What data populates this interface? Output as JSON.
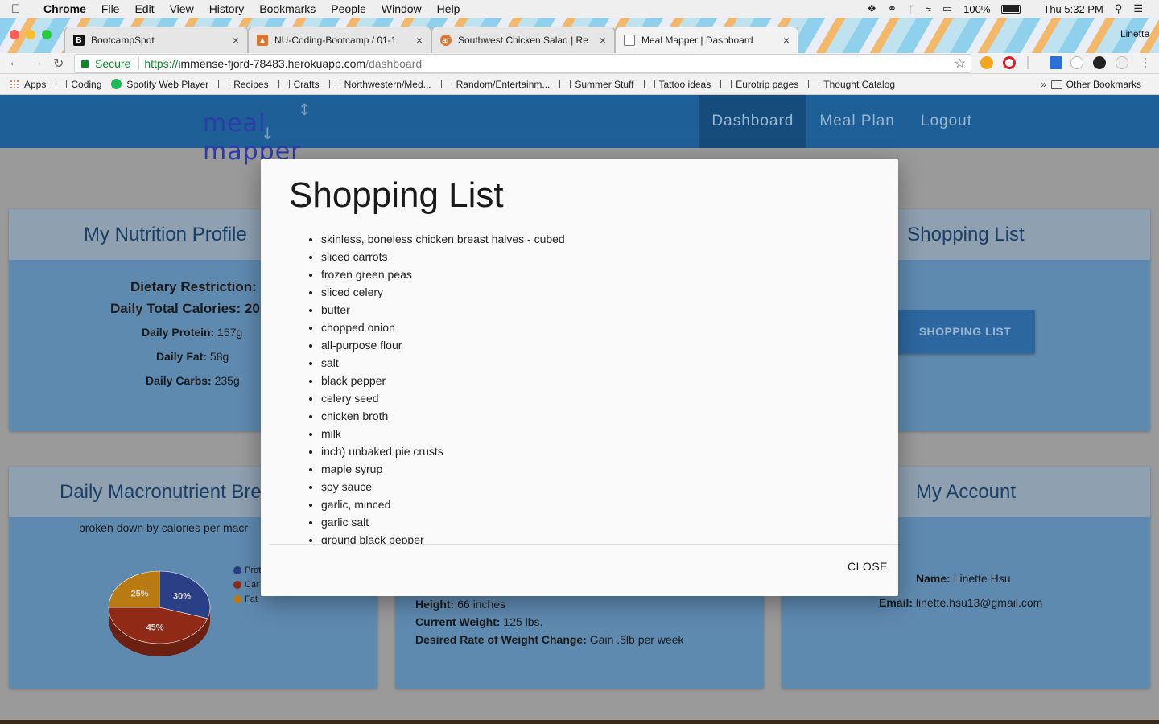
{
  "menubar": {
    "app": "Chrome",
    "items": [
      "File",
      "Edit",
      "View",
      "History",
      "Bookmarks",
      "People",
      "Window",
      "Help"
    ],
    "battery": "100%",
    "clock": "Thu 5:32 PM"
  },
  "tabs": [
    {
      "title": "BootcampSpot",
      "favicon": "B"
    },
    {
      "title": "NU-Coding-Bootcamp / 01-1",
      "favicon": "fox"
    },
    {
      "title": "Southwest Chicken Salad | Re",
      "favicon": "ar"
    },
    {
      "title": "Meal Mapper | Dashboard",
      "favicon": "doc"
    }
  ],
  "profile_name": "Linette",
  "omnibox": {
    "secure_label": "Secure",
    "url_scheme": "https://",
    "url_host": "immense-fjord-78483.herokuapp.com",
    "url_path": "/dashboard"
  },
  "bookmarks": [
    "Apps",
    "Coding",
    "Spotify Web Player",
    "Recipes",
    "Crafts",
    "Northwestern/Med...",
    "Random/Entertainm...",
    "Summer Stuff",
    "Tattoo ideas",
    "Eurotrip pages",
    "Thought Catalog"
  ],
  "other_bookmarks": "Other Bookmarks",
  "site": {
    "logo_text": "meal mapper",
    "nav": [
      "Dashboard",
      "Meal Plan",
      "Logout"
    ]
  },
  "nutrition_card": {
    "title": "My Nutrition Profile",
    "restriction_label": "Dietary Restriction:",
    "calories_label": "Daily Total Calories: 20",
    "protein_label": "Daily Protein:",
    "protein_value": " 157g",
    "fat_label": "Daily Fat:",
    "fat_value": " 58g",
    "carbs_label": "Daily Carbs:",
    "carbs_value": " 235g"
  },
  "shopping_card": {
    "title": "Shopping List",
    "button": "SHOPPING LIST"
  },
  "macro_card": {
    "title": "Daily Macronutrient Bre",
    "subtitle": "broken down by calories per macr",
    "legend": [
      "Prot",
      "Car",
      "Fat"
    ]
  },
  "chart_data": {
    "type": "pie",
    "categories": [
      "Protein",
      "Carbs",
      "Fat"
    ],
    "values": [
      30,
      45,
      25
    ],
    "labels": [
      "30%",
      "45%",
      "25%"
    ],
    "colors": [
      "#2a3f86",
      "#8e2a16",
      "#b97a12"
    ]
  },
  "body_card": {
    "height_label": "Height:",
    "height_value": " 66 inches",
    "weight_label": "Current Weight:",
    "weight_value": " 125 lbs.",
    "rate_label": "Desired Rate of Weight Change:",
    "rate_value": " Gain .5lb per week"
  },
  "account_card": {
    "title": "My Account",
    "name_label": "Name:",
    "name_value": " Linette Hsu",
    "email_label": "Email:",
    "email_value": " linette.hsu13@gmail.com"
  },
  "modal": {
    "title": "Shopping List",
    "items": [
      "skinless, boneless chicken breast halves - cubed",
      "sliced carrots",
      "frozen green peas",
      "sliced celery",
      "butter",
      "chopped onion",
      "all-purpose flour",
      "salt",
      "black pepper",
      "celery seed",
      "chicken broth",
      "milk",
      "inch) unbaked pie crusts",
      "maple syrup",
      "soy sauce",
      "garlic, minced",
      "garlic salt",
      "ground black pepper"
    ],
    "close_label": "CLOSE"
  }
}
